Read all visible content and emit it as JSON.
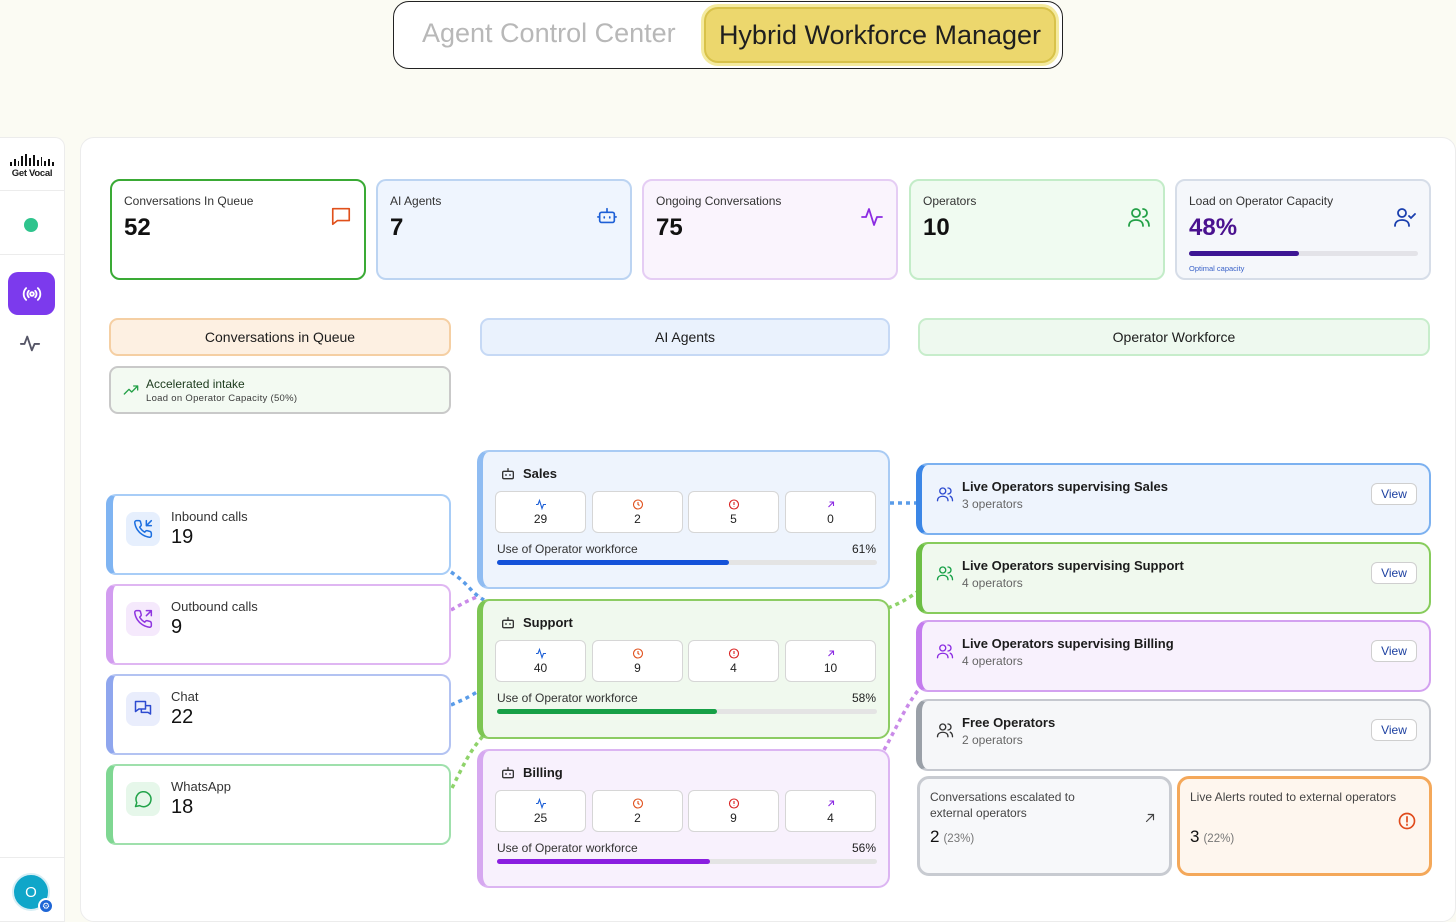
{
  "mode_toggle": {
    "inactive": "Agent Control Center",
    "active": "Hybrid Workforce Manager"
  },
  "brand": {
    "logo_text": "Get Vocal"
  },
  "user": {
    "avatar_initial": "O"
  },
  "stats": [
    {
      "label": "Conversations In Queue",
      "value": "52",
      "icon": "message-square-icon",
      "color": "#3aaa35"
    },
    {
      "label": "AI Agents",
      "value": "7",
      "icon": "bot-icon",
      "color": "#1d5fd6"
    },
    {
      "label": "Ongoing Conversations",
      "value": "75",
      "icon": "activity-icon",
      "color": "#8b2be2"
    },
    {
      "label": "Operators",
      "value": "10",
      "icon": "users-icon",
      "color": "#23a047"
    },
    {
      "label": "Load on Operator Capacity",
      "value": "48%",
      "icon": "user-check-icon",
      "color": "#1a3fae",
      "progress": 0.48,
      "caption": "Optimal capacity"
    }
  ],
  "columns": {
    "queue": "Conversations in Queue",
    "ai": "AI Agents",
    "operators": "Operator Workforce"
  },
  "intake": {
    "title": "Accelerated intake",
    "subtitle": "Load on Operator Capacity (50%)"
  },
  "channels": [
    {
      "name": "Inbound calls",
      "value": "19",
      "icon": "phone-incoming-icon",
      "color": "#1d6fe0"
    },
    {
      "name": "Outbound calls",
      "value": "9",
      "icon": "phone-outgoing-icon",
      "color": "#8f35e0"
    },
    {
      "name": "Chat",
      "value": "22",
      "icon": "messages-icon",
      "color": "#2d4bd0"
    },
    {
      "name": "WhatsApp",
      "value": "18",
      "icon": "whatsapp-icon",
      "color": "#22a34a"
    }
  ],
  "agents": [
    {
      "name": "Sales",
      "metrics": [
        "29",
        "2",
        "5",
        "0"
      ],
      "usage_label": "Use of Operator workforce",
      "usage": "61%",
      "usage_value": 0.61,
      "color": "#1452d9"
    },
    {
      "name": "Support",
      "metrics": [
        "40",
        "9",
        "4",
        "10"
      ],
      "usage_label": "Use of Operator workforce",
      "usage": "58%",
      "usage_value": 0.58,
      "color": "#16a046"
    },
    {
      "name": "Billing",
      "metrics": [
        "25",
        "2",
        "9",
        "4"
      ],
      "usage_label": "Use of Operator workforce",
      "usage": "56%",
      "usage_value": 0.56,
      "color": "#8a1ee0"
    }
  ],
  "operators": [
    {
      "name": "Live Operators supervising Sales",
      "count": "3 operators",
      "button": "View"
    },
    {
      "name": "Live Operators supervising Support",
      "count": "4 operators",
      "button": "View"
    },
    {
      "name": "Live Operators supervising Billing",
      "count": "4 operators",
      "button": "View"
    },
    {
      "name": "Free Operators",
      "count": "2 operators",
      "button": "View"
    }
  ],
  "escalated": {
    "label": "Conversations escalated to external operators",
    "value": "2",
    "pct": "(23%)"
  },
  "alerts": {
    "label": "Live Alerts routed to external operators",
    "value": "3",
    "pct": "(22%)"
  }
}
